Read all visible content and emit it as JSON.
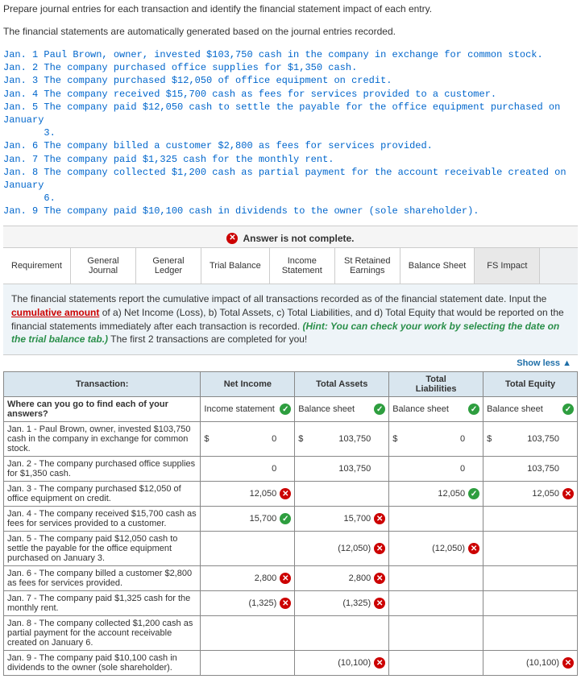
{
  "intro1": "Prepare journal entries for each transaction and identify the financial statement impact of each entry.",
  "intro2": "The financial statements are automatically generated based on the journal entries recorded.",
  "trans_text": "Jan. 1 Paul Brown, owner, invested $103,750 cash in the company in exchange for common stock.\nJan. 2 The company purchased office supplies for $1,350 cash.\nJan. 3 The company purchased $12,050 of office equipment on credit.\nJan. 4 The company received $15,700 cash as fees for services provided to a customer.\nJan. 5 The company paid $12,050 cash to settle the payable for the office equipment purchased on January\n       3.\nJan. 6 The company billed a customer $2,800 as fees for services provided.\nJan. 7 The company paid $1,325 cash for the monthly rent.\nJan. 8 The company collected $1,200 cash as partial payment for the account receivable created on January\n       6.\nJan. 9 The company paid $10,100 cash in dividends to the owner (sole shareholder).",
  "not_complete": "Answer is not complete.",
  "tabs": {
    "req": "Requirement",
    "gj": "General\nJournal",
    "gl": "General\nLedger",
    "tb": "Trial Balance",
    "inc": "Income\nStatement",
    "re": "St Retained\nEarnings",
    "bs": "Balance Sheet",
    "fs": "FS Impact"
  },
  "hint_p1": "The financial statements report the cumulative impact of all transactions recorded as of the financial statement date. Input the ",
  "hint_cum": "cumulative amount",
  "hint_p2": " of a) Net Income (Loss), b) Total Assets, c) Total Liabilities, and d) Total Equity that would be reported on the financial statements immediately after each transaction is recorded. ",
  "hint_italic": "(Hint: You can check your work by selecting the date on the trial balance tab.)",
  "hint_p3": " The first 2 transactions are completed for you!",
  "showless": "Show less",
  "headers": {
    "trans": "Transaction:",
    "ni": "Net Income",
    "ta": "Total Assets",
    "tl": "Total\nLiabilities",
    "te": "Total Equity"
  },
  "row0": {
    "label": "Where can you go to find each of your answers?",
    "ni": "Income statement",
    "ta": "Balance sheet",
    "tl": "Balance sheet",
    "te": "Balance sheet"
  },
  "rows": [
    {
      "label": "Jan. 1 - Paul Brown, owner, invested $103,750 cash in the company in exchange for common stock.",
      "ni": "0",
      "ni_d": "$",
      "ta": "103,750",
      "ta_d": "$",
      "tl": "0",
      "tl_d": "$",
      "te": "103,750",
      "te_d": "$"
    },
    {
      "label": "Jan. 2 - The company purchased office supplies for $1,350 cash.",
      "ni": "0",
      "ta": "103,750",
      "tl": "0",
      "te": "103,750"
    },
    {
      "label": "Jan. 3 - The company purchased $12,050 of office equipment on credit.",
      "ni": "12,050",
      "ni_m": "bad",
      "tl": "12,050",
      "tl_m": "ok",
      "te": "12,050",
      "te_m": "bad"
    },
    {
      "label": "Jan. 4 - The company received $15,700 cash as fees for services provided to a customer.",
      "ni": "15,700",
      "ni_m": "ok",
      "ta": "15,700",
      "ta_m": "bad"
    },
    {
      "label": "Jan. 5 - The company paid $12,050 cash to settle the payable for the office equipment purchased on January 3.",
      "ta": "(12,050)",
      "ta_m": "bad",
      "tl": "(12,050)",
      "tl_m": "bad"
    },
    {
      "label": "Jan. 6 - The company billed a customer $2,800 as fees for services provided.",
      "ni": "2,800",
      "ni_m": "bad",
      "ta": "2,800",
      "ta_m": "bad"
    },
    {
      "label": "Jan. 7 - The company paid $1,325 cash for the monthly rent.",
      "ni": "(1,325)",
      "ni_m": "bad",
      "ta": "(1,325)",
      "ta_m": "bad"
    },
    {
      "label": "Jan. 8 - The company collected $1,200 cash as partial payment for the account receivable created on January 6."
    },
    {
      "label": "Jan. 9 - The company paid $10,100 cash in dividends to the owner (sole shareholder).",
      "ta": "(10,100)",
      "ta_m": "bad",
      "te": "(10,100)",
      "te_m": "bad"
    }
  ]
}
